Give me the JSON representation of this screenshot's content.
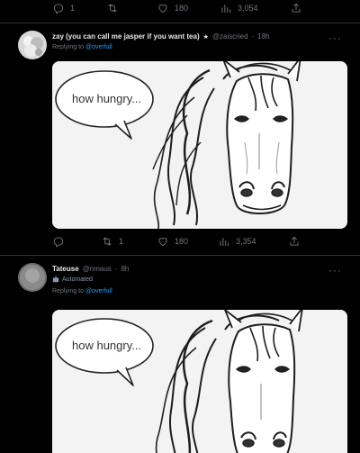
{
  "top_actions": {
    "reply_count": "1",
    "retweet_count": "",
    "like_count": "180",
    "views_count": "3,054"
  },
  "tweets": [
    {
      "display_name": "zay (you can call me jasper if you want tea)",
      "verified_badge": "★",
      "handle": "@zaiscried",
      "sep": "·",
      "time": "18h",
      "reply_prefix": "Replying to",
      "reply_mention": "@overfull",
      "image_text": "how hungry...",
      "actions": {
        "reply_count": "",
        "retweet_count": "1",
        "like_count": "180",
        "views_count": "3,354"
      }
    },
    {
      "display_name": "Tateuse",
      "handle": "@nmaus",
      "sep": "·",
      "time": "8h",
      "sub_label": "Automated",
      "reply_prefix": "Replying to",
      "reply_mention": "@overfull",
      "image_text": "how hungry..."
    }
  ],
  "colors": {
    "background": "#000000",
    "text": "#e7e9ea",
    "muted": "#71767b",
    "accent": "#1d9bf0",
    "divider": "#2f3336"
  },
  "icons": [
    "reply-icon",
    "retweet-icon",
    "like-icon",
    "views-icon",
    "share-icon",
    "more-icon",
    "bot-icon"
  ]
}
